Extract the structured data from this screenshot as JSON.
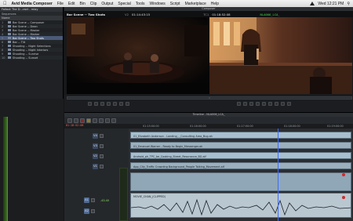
{
  "menubar": {
    "app_name": "Avid Media Composer",
    "items": [
      "File",
      "Edit",
      "Bin",
      "Clip",
      "Output",
      "Special",
      "Tools",
      "Windows",
      "Script",
      "Marketplace",
      "Help"
    ],
    "clock": "Wed 12:21 PM"
  },
  "bin": {
    "title": "Fallout The D...ract - mlay",
    "tab": "Sequences",
    "header": "Name",
    "rows": [
      {
        "num": "1",
        "name": "Bar Scene -- Composer"
      },
      {
        "num": "2",
        "name": "Bar Scene -- Dean"
      },
      {
        "num": "3",
        "name": "Bar Scene -- Master"
      },
      {
        "num": "4",
        "name": "Bar Scene -- Marker"
      },
      {
        "num": "5",
        "name": "Bar Scene -- Two Shots"
      },
      {
        "num": "6",
        "name": "Bar -- Tilt"
      },
      {
        "num": "7",
        "name": "Shooting -- Night Selections"
      },
      {
        "num": "8",
        "name": "Shooting -- Night Interiors"
      },
      {
        "num": "9",
        "name": "Shooting -- Sunrise"
      },
      {
        "num": "10",
        "name": "Shooting -- Sunset"
      }
    ],
    "selected_index": 4
  },
  "composer": {
    "title": "Composer",
    "sequence_name": "Bar Scene -- Two Shots",
    "src_label": "V2",
    "src_tc": "01:14:43:15",
    "rec_label": "TC1",
    "rec_tc": "01:18:52:08",
    "rec_clip": "NLA006_LCA_"
  },
  "timeline": {
    "title": "Timeline - NLA006_LCA_",
    "timecode": "01:18:52:08",
    "ruler": [
      "01:15:00:00",
      "01:16:00:00",
      "01:17:00:00",
      "01:18:00:00",
      "01:19:00:00"
    ],
    "tracks": [
      {
        "label": "V4"
      },
      {
        "label": "V3"
      },
      {
        "label": "V2"
      },
      {
        "label": "V1"
      },
      {
        "label": "A1"
      },
      {
        "label": "A2"
      }
    ],
    "clips": [
      {
        "name": "01_Elizabeth Anderson - Landing_-_Consulting Area_Bug.ah"
      },
      {
        "name": "01_Emanuel Warner - Ready to Begin_Messenger.ah"
      },
      {
        "name": "Android_ph_TPC_be_Cooking_Street_Resonance_BG.aif"
      },
      {
        "name": "App_City_Traffic Crowding Background_People Talking_Movement.aif"
      },
      {
        "name": "MOVIE_CHAN_(CLIPPED)"
      }
    ],
    "level": "-43.40",
    "track_meter": "-43.40"
  }
}
